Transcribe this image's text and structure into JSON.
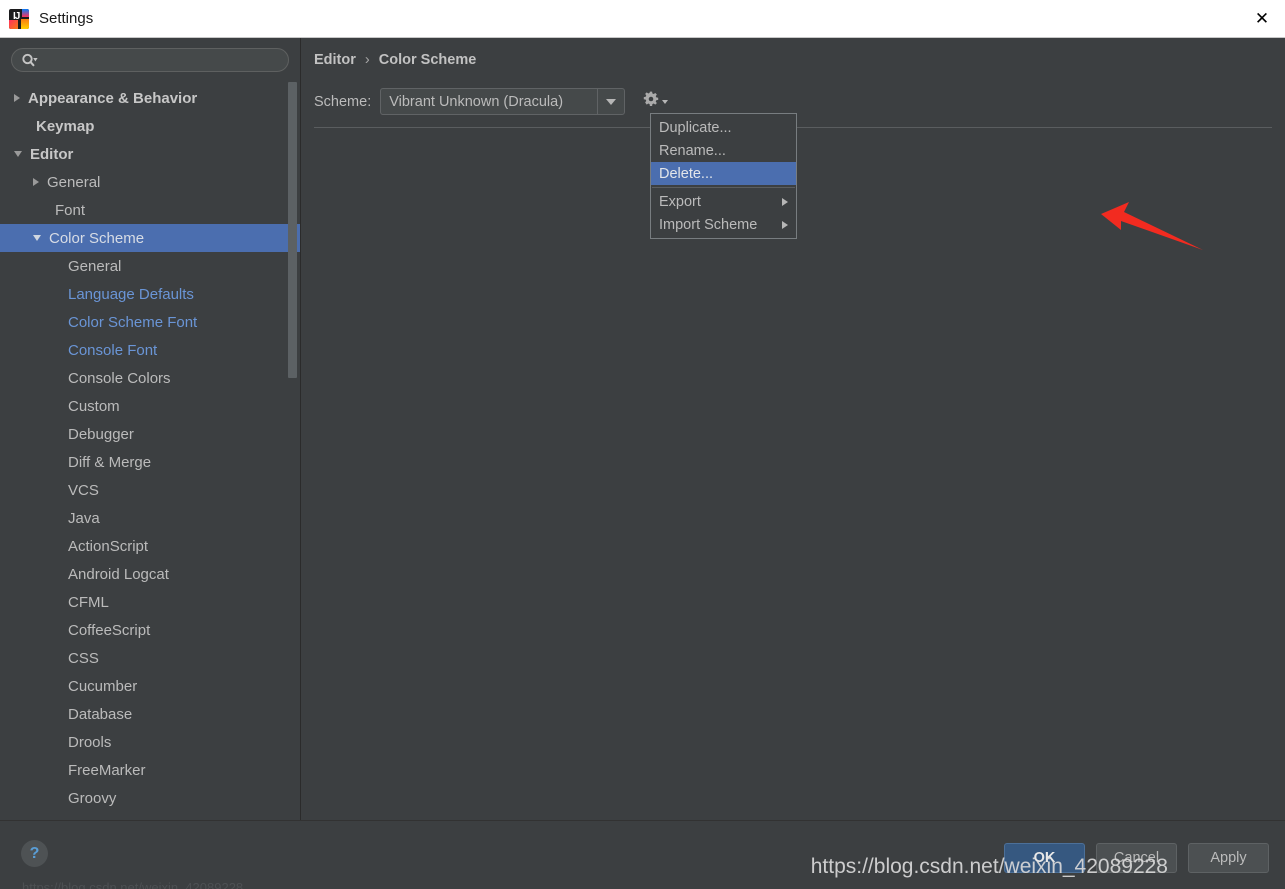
{
  "window": {
    "title": "Settings",
    "app_icon": "intellij-idea-logo",
    "close_label": "✕"
  },
  "sidebar": {
    "search": {
      "value": "",
      "placeholder": "",
      "icon": "search-icon"
    },
    "items": [
      {
        "label": "Appearance & Behavior",
        "level": 0,
        "arrow": "collapsed",
        "selected": false,
        "modified": false
      },
      {
        "label": "Keymap",
        "level": 0,
        "arrow": "none",
        "selected": false,
        "modified": false
      },
      {
        "label": "Editor",
        "level": 0,
        "arrow": "expanded",
        "selected": false,
        "modified": false
      },
      {
        "label": "General",
        "level": 1,
        "arrow": "collapsed",
        "selected": false,
        "modified": false
      },
      {
        "label": "Font",
        "level": 1,
        "arrow": "none",
        "selected": false,
        "modified": false
      },
      {
        "label": "Color Scheme",
        "level": 1,
        "arrow": "expanded",
        "selected": true,
        "modified": false
      },
      {
        "label": "General",
        "level": 2,
        "arrow": "none",
        "selected": false,
        "modified": false
      },
      {
        "label": "Language Defaults",
        "level": 2,
        "arrow": "none",
        "selected": false,
        "modified": true
      },
      {
        "label": "Color Scheme Font",
        "level": 2,
        "arrow": "none",
        "selected": false,
        "modified": true
      },
      {
        "label": "Console Font",
        "level": 2,
        "arrow": "none",
        "selected": false,
        "modified": true
      },
      {
        "label": "Console Colors",
        "level": 2,
        "arrow": "none",
        "selected": false,
        "modified": false
      },
      {
        "label": "Custom",
        "level": 2,
        "arrow": "none",
        "selected": false,
        "modified": false
      },
      {
        "label": "Debugger",
        "level": 2,
        "arrow": "none",
        "selected": false,
        "modified": false
      },
      {
        "label": "Diff & Merge",
        "level": 2,
        "arrow": "none",
        "selected": false,
        "modified": false
      },
      {
        "label": "VCS",
        "level": 2,
        "arrow": "none",
        "selected": false,
        "modified": false
      },
      {
        "label": "Java",
        "level": 2,
        "arrow": "none",
        "selected": false,
        "modified": false
      },
      {
        "label": "ActionScript",
        "level": 2,
        "arrow": "none",
        "selected": false,
        "modified": false
      },
      {
        "label": "Android Logcat",
        "level": 2,
        "arrow": "none",
        "selected": false,
        "modified": false
      },
      {
        "label": "CFML",
        "level": 2,
        "arrow": "none",
        "selected": false,
        "modified": false
      },
      {
        "label": "CoffeeScript",
        "level": 2,
        "arrow": "none",
        "selected": false,
        "modified": false
      },
      {
        "label": "CSS",
        "level": 2,
        "arrow": "none",
        "selected": false,
        "modified": false
      },
      {
        "label": "Cucumber",
        "level": 2,
        "arrow": "none",
        "selected": false,
        "modified": false
      },
      {
        "label": "Database",
        "level": 2,
        "arrow": "none",
        "selected": false,
        "modified": false
      },
      {
        "label": "Drools",
        "level": 2,
        "arrow": "none",
        "selected": false,
        "modified": false
      },
      {
        "label": "FreeMarker",
        "level": 2,
        "arrow": "none",
        "selected": false,
        "modified": false
      },
      {
        "label": "Groovy",
        "level": 2,
        "arrow": "none",
        "selected": false,
        "modified": false
      }
    ]
  },
  "content": {
    "breadcrumb": {
      "parent": "Editor",
      "separator": "›",
      "current": "Color Scheme"
    },
    "scheme": {
      "label": "Scheme:",
      "value": "Vibrant Unknown (Dracula)",
      "dropdown_icon": "chevron-down-icon",
      "gear_icon": "gear-icon"
    }
  },
  "gear_menu": {
    "items": [
      {
        "label": "Duplicate...",
        "highlighted": false,
        "submenu": false
      },
      {
        "label": "Rename...",
        "highlighted": false,
        "submenu": false
      },
      {
        "label": "Delete...",
        "highlighted": true,
        "submenu": false
      },
      {
        "label": "Export",
        "highlighted": false,
        "submenu": true
      },
      {
        "label": "Import Scheme",
        "highlighted": false,
        "submenu": true
      }
    ],
    "separator_after_index": 3
  },
  "annotation": {
    "arrow_color": "#f22b20",
    "points_to": "Delete..."
  },
  "footer": {
    "help_label": "?",
    "ok_label": "OK",
    "cancel_label": "Cancel",
    "apply_label": "Apply"
  },
  "watermark": {
    "text": "https://blog.csdn.net/weixin_42089228",
    "bottom_text": "https://blog.csdn.net/weixin_42089228"
  },
  "colors": {
    "accent_selection": "#4b6eaf",
    "window_bg": "#3c3f41",
    "modified_link": "#6a95d6",
    "titlebar_bg": "#ffffff",
    "ok_button_bg": "#365880",
    "annotation_red": "#f22b20"
  }
}
